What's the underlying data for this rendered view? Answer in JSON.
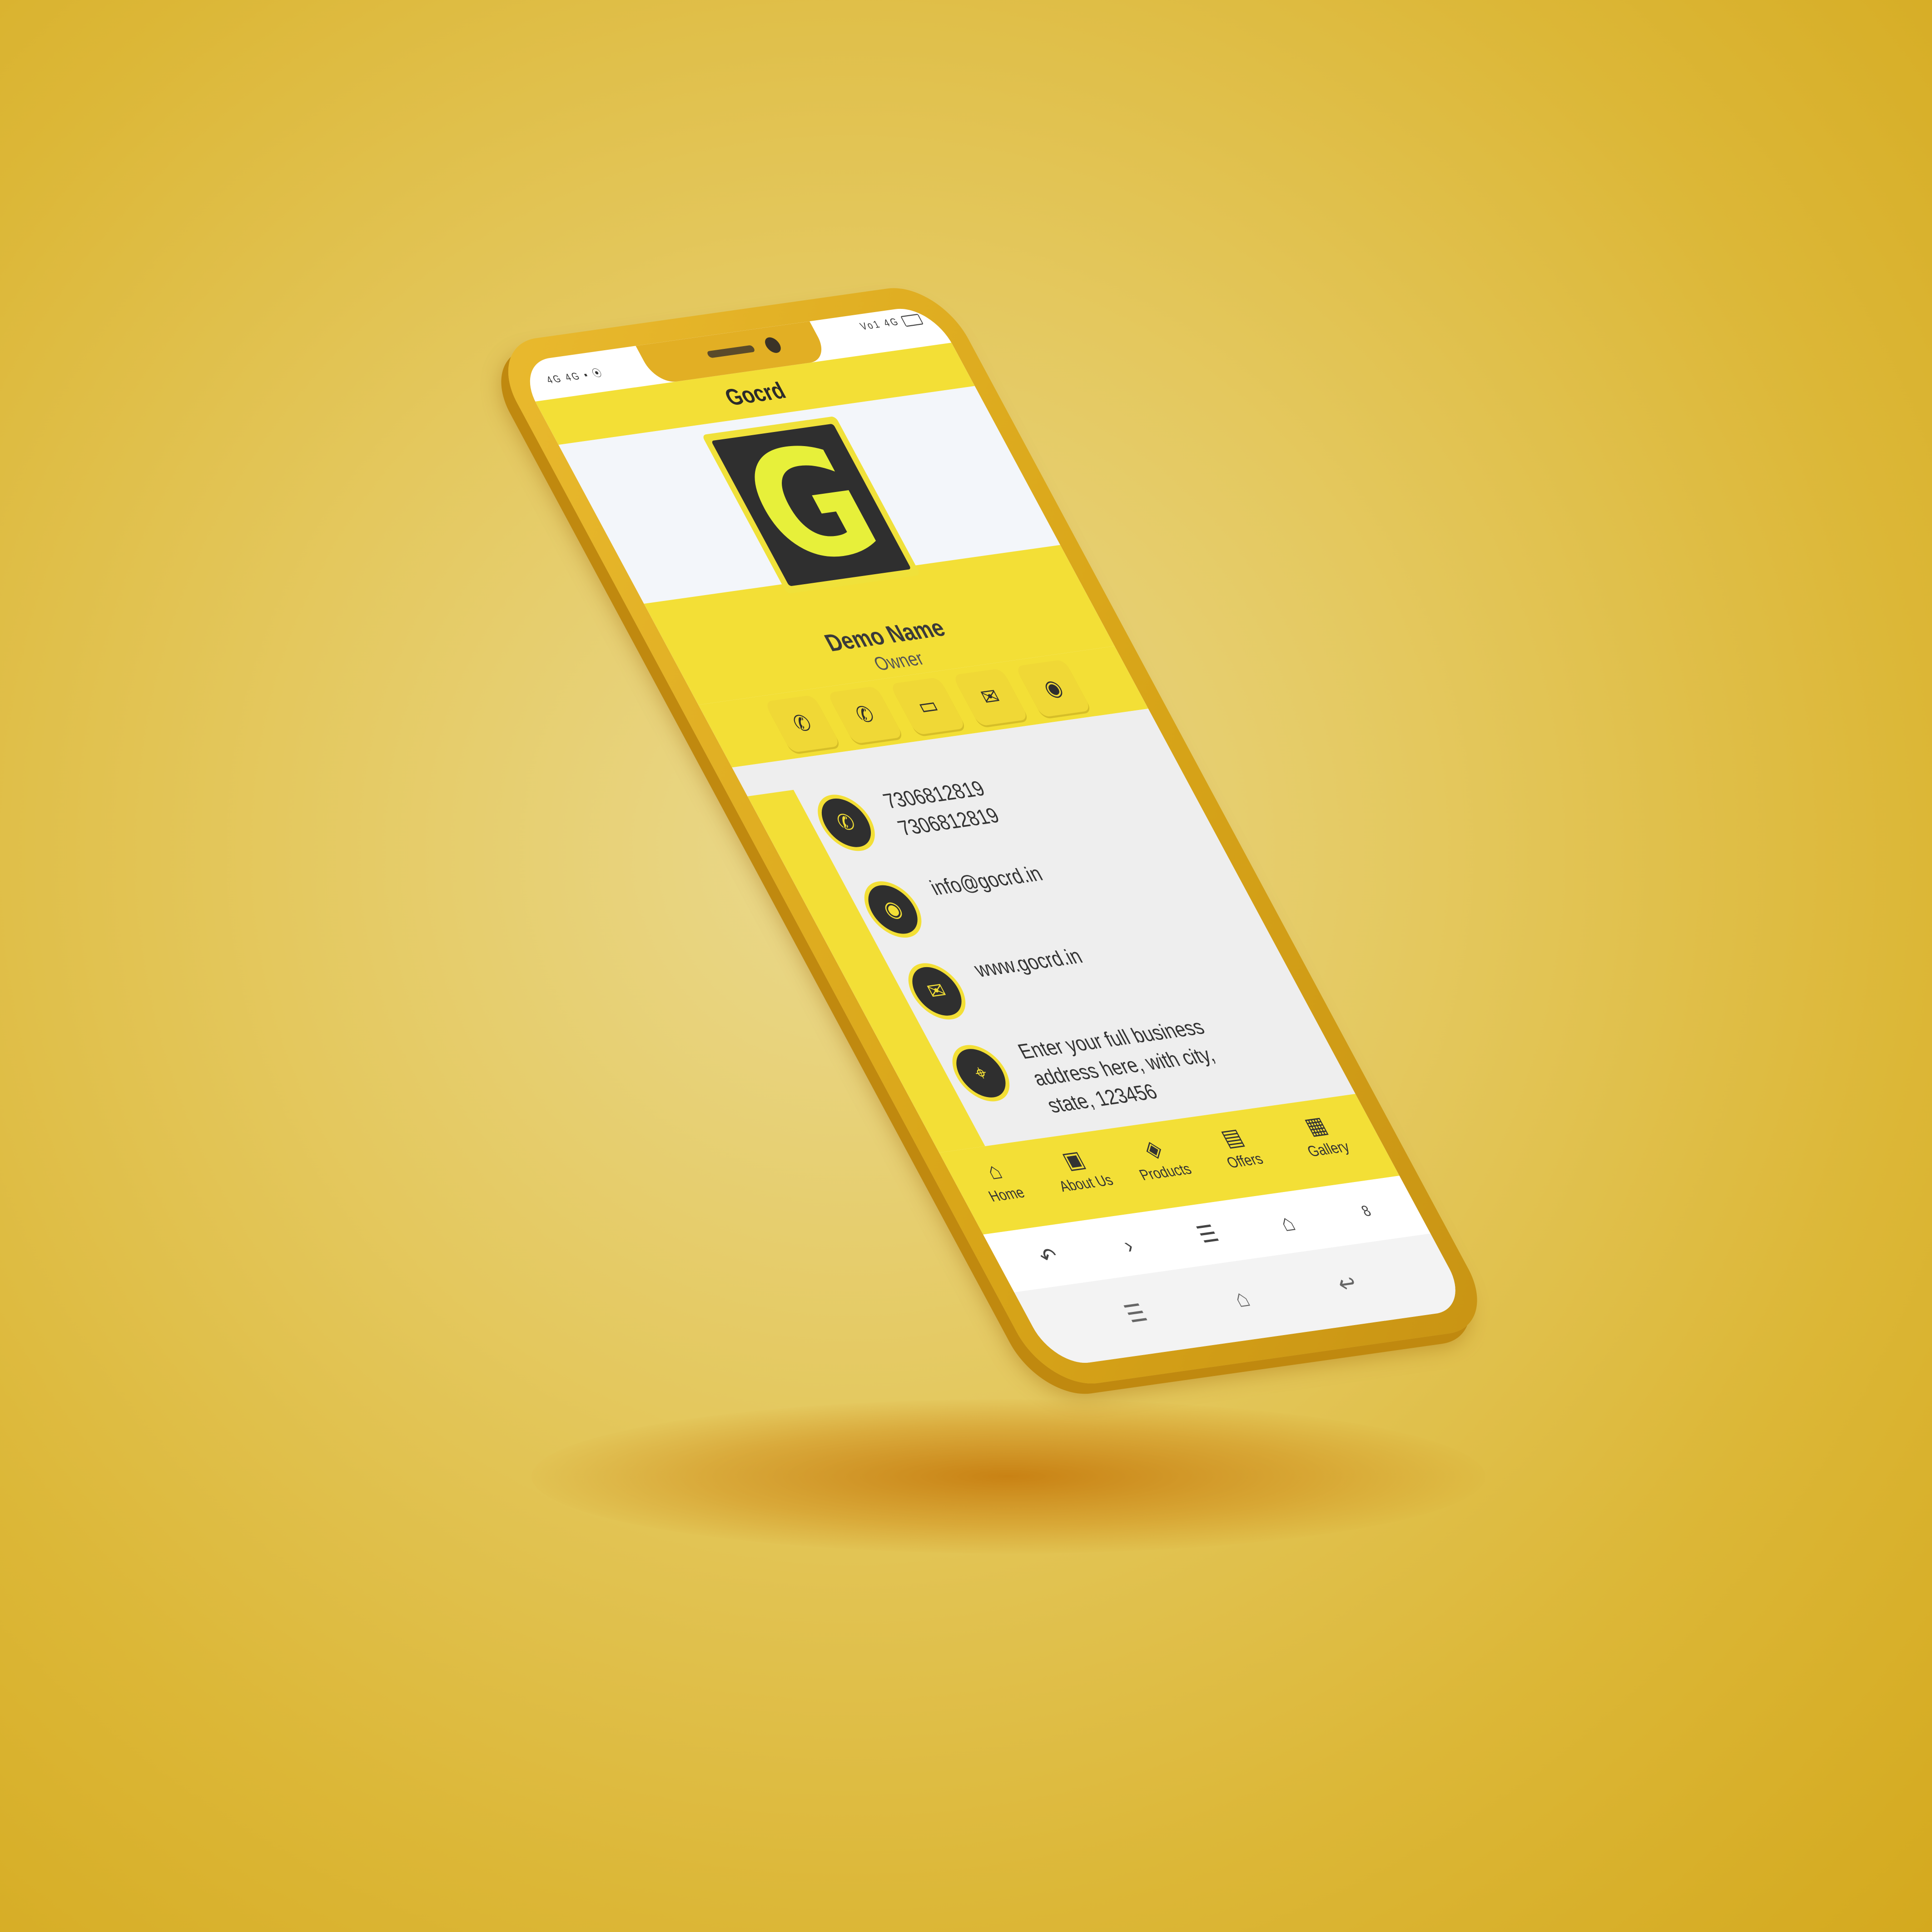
{
  "status": {
    "left": "4G 4G ▪ ⦿",
    "right": "Vo1 4G"
  },
  "app": {
    "title": "Gocrd"
  },
  "logo": {
    "letter": "G"
  },
  "profile": {
    "name": "Demo Name",
    "role": "Owner"
  },
  "actions": [
    {
      "icon": "phone-icon",
      "glyph": "✆"
    },
    {
      "icon": "whatsapp-icon",
      "glyph": "✆"
    },
    {
      "icon": "map-icon",
      "glyph": "▭"
    },
    {
      "icon": "mail-icon",
      "glyph": "✉"
    },
    {
      "icon": "chrome-icon",
      "glyph": "◉"
    }
  ],
  "contacts": {
    "phone": {
      "line1": "7306812819",
      "line2": "7306812819",
      "glyph": "✆"
    },
    "email": {
      "text": "info@gocrd.in",
      "glyph": "◉"
    },
    "website": {
      "text": "www.gocrd.in",
      "glyph": "✉"
    },
    "address": {
      "text": "Enter your full business address here, with city, state, 123456",
      "glyph": "⌖"
    }
  },
  "nav": {
    "home": {
      "label": "Home",
      "glyph": "⌂"
    },
    "about": {
      "label": "About Us",
      "glyph": "▣"
    },
    "products": {
      "label": "Products",
      "glyph": "◈"
    },
    "offers": {
      "label": "Offers",
      "glyph": "▤"
    },
    "gallery": {
      "label": "Gallery",
      "glyph": "▦"
    }
  },
  "browser": {
    "back": "↶",
    "forward": "›",
    "menu": "☰",
    "home": "⌂",
    "tabs": "8"
  },
  "system_nav": {
    "menu": "☰",
    "home": "⌂",
    "back": "↩"
  },
  "colors": {
    "background": "#e4c85e",
    "phone_body": "#d9a619",
    "accent_yellow": "#f3df36",
    "dark": "#2f2f2f"
  }
}
